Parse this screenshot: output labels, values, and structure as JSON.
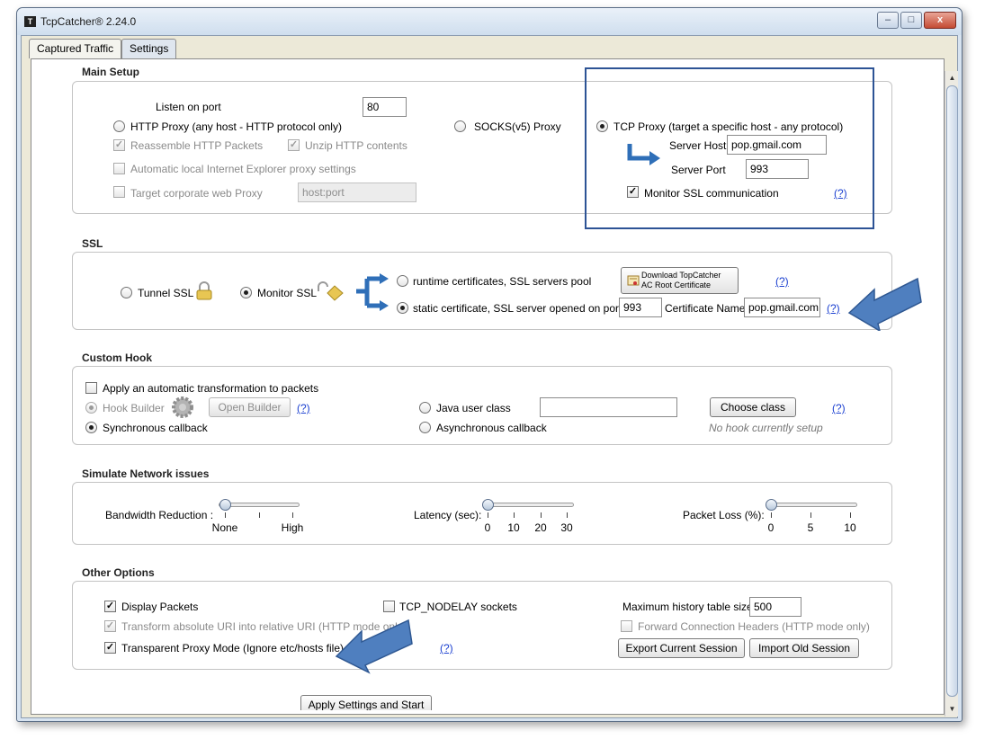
{
  "window": {
    "title": "TcpCatcher®  2.24.0",
    "icon_name": "tcpcatcher-app-icon",
    "controls": {
      "minimize": "–",
      "maximize": "□",
      "close": "x"
    }
  },
  "tabs": [
    {
      "label": "Captured Traffic",
      "active": false
    },
    {
      "label": "Settings",
      "active": true
    }
  ],
  "main_setup": {
    "title": "Main Setup",
    "listen_label": "Listen on port",
    "listen_port": "80",
    "http_proxy": "HTTP Proxy (any host - HTTP protocol only)",
    "reassemble": "Reassemble HTTP Packets",
    "unzip": "Unzip HTTP contents",
    "auto_ie": "Automatic local Internet Explorer proxy settings",
    "target_corp": "Target corporate web Proxy",
    "corp_placeholder": "host:port",
    "socks": "SOCKS(v5) Proxy",
    "tcp_proxy": "TCP Proxy (target a specific host - any protocol)",
    "server_host_label": "Server Host",
    "server_host": "pop.gmail.com",
    "server_port_label": "Server Port",
    "server_port": "993",
    "monitor_ssl": "Monitor SSL communication",
    "help": "(?)"
  },
  "ssl": {
    "title": "SSL",
    "tunnel": "Tunnel SSL",
    "monitor": "Monitor SSL",
    "runtime": "runtime certificates, SSL servers pool",
    "static": "static certificate, SSL server opened on port:",
    "static_port": "993",
    "cert_name_label": "Certificate Name",
    "cert_name": "pop.gmail.com",
    "download_line1": "Download TopCatcher",
    "download_line2": "AC Root Certificate",
    "help": "(?)"
  },
  "custom_hook": {
    "title": "Custom Hook",
    "apply_auto": "Apply an automatic transformation to packets",
    "hook_builder": "Hook Builder",
    "open_builder": "Open Builder",
    "sync": "Synchronous callback",
    "java_class": "Java user class",
    "async": "Asynchronous callback",
    "choose_class": "Choose class",
    "no_hook": "No hook currently setup",
    "help": "(?)"
  },
  "network": {
    "title": "Simulate Network issues",
    "bandwidth_label": "Bandwidth Reduction :",
    "bandwidth_ticks": [
      "None",
      "High"
    ],
    "bandwidth_value": 0,
    "latency_label": "Latency (sec):",
    "latency_ticks": [
      "0",
      "10",
      "20",
      "30"
    ],
    "latency_value": 0,
    "loss_label": "Packet Loss (%):",
    "loss_ticks": [
      "0",
      "5",
      "10"
    ],
    "loss_value": 0
  },
  "other": {
    "title": "Other Options",
    "display_packets": "Display Packets",
    "transform_uri": "Transform absolute URI into relative URI (HTTP mode only)",
    "transparent": "Transparent Proxy Mode (Ignore etc/hosts file)",
    "tcp_nodelay": "TCP_NODELAY sockets",
    "max_history_label": "Maximum history table size",
    "max_history": "500",
    "forward_headers": "Forward Connection Headers (HTTP mode only)",
    "export": "Export Current Session",
    "import": "Import Old Session",
    "help": "(?)"
  },
  "apply_button": "Apply Settings and Start",
  "colors": {
    "annotation_arrow": "#4f7fbf",
    "highlight_box": "#2d5395",
    "connector": "#2f6fb8"
  }
}
